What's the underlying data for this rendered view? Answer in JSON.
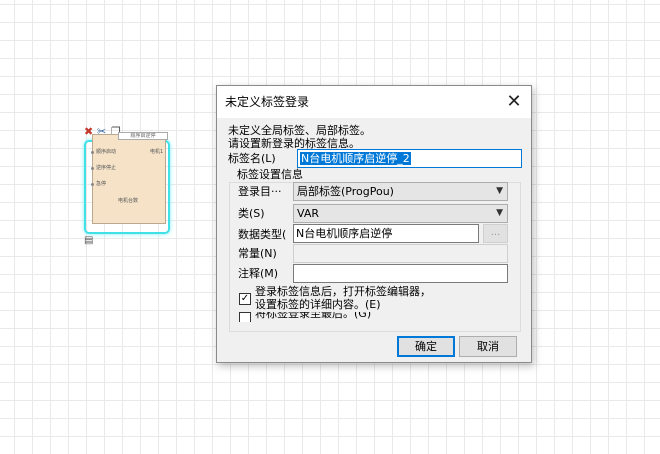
{
  "canvas": {
    "block": {
      "title": "顺序启逆停",
      "pins_left": [
        "顺序启动",
        "逆序停止",
        "急停"
      ],
      "pins_right": [
        "电机1"
      ],
      "pin_bottom": "电机台数",
      "toolbar_icons": [
        "delete-icon",
        "cut-icon",
        "copy-icon"
      ]
    }
  },
  "dialog": {
    "title": "未定义标签登录",
    "message_line1": "未定义全局标签、局部标签。",
    "message_line2": "请设置新登录的标签信息。",
    "label_name_label": "标签名(L)",
    "label_name_value": "N台电机顺序启逆停_2",
    "group_label": "标签设置信息",
    "register_label": "登录目···",
    "register_value": "局部标签(ProgPou)",
    "class_label": "类(S)",
    "class_value": "VAR",
    "datatype_label": "数据类型(",
    "datatype_value": "N台电机顺序启逆停",
    "datatype_button": "...",
    "constant_label": "常量(N)",
    "constant_value": "",
    "comment_label": "注释(M)",
    "comment_value": "",
    "open_editor_line1": "登录标签信息后，打开标签编辑器，",
    "open_editor_line2": "设置标签的详细内容。(E)",
    "open_editor_checked": "✓",
    "last_line_partial": "将标签登录至最后。(G)",
    "ok_label": "确定",
    "cancel_label": "取消",
    "close_glyph": "✕"
  }
}
